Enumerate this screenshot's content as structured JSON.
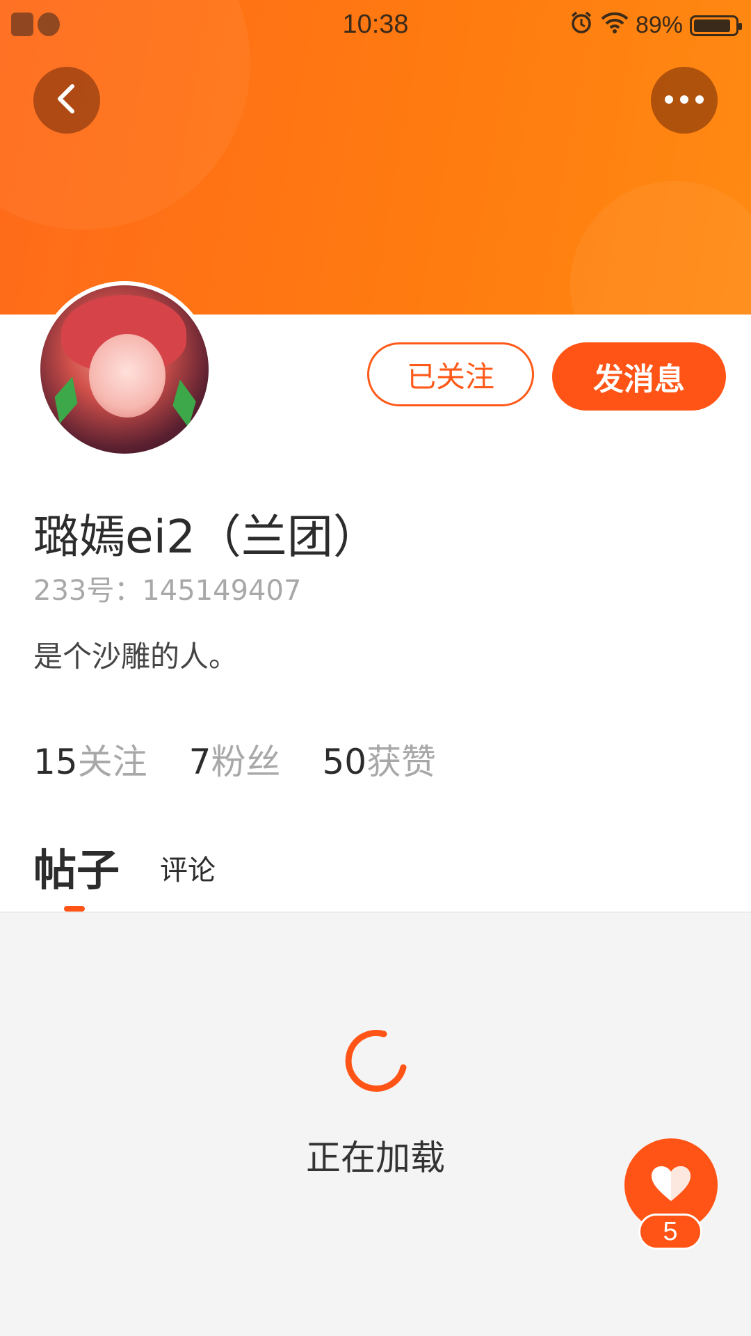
{
  "status_bar": {
    "time": "10:38",
    "battery": "89%",
    "battery_level": 0.89,
    "icons": [
      "app-notification-icon",
      "clock-app-icon",
      "alarm-icon",
      "wifi-icon",
      "battery-icon"
    ]
  },
  "header": {
    "back_icon": "chevron-left-icon",
    "more_icon": "more-dots-icon",
    "colors": {
      "gradient_start": "#ff6a1a",
      "gradient_end": "#ff8a12"
    }
  },
  "profile": {
    "followed_label": "已关注",
    "message_label": "发消息",
    "name": "璐嫣ei2（兰团）",
    "id_text": "233号：145149407",
    "bio": "是个沙雕的人。",
    "stats": [
      {
        "num": "15",
        "label": "关注"
      },
      {
        "num": "7",
        "label": "粉丝"
      },
      {
        "num": "50",
        "label": "获赞"
      }
    ]
  },
  "tabs": [
    {
      "label": "帖子",
      "active": true
    },
    {
      "label": "评论",
      "active": false
    }
  ],
  "content": {
    "loading_text": "正在加载"
  },
  "like": {
    "icon": "heart-icon",
    "count": "5"
  },
  "colors": {
    "accent": "#ff5416"
  }
}
